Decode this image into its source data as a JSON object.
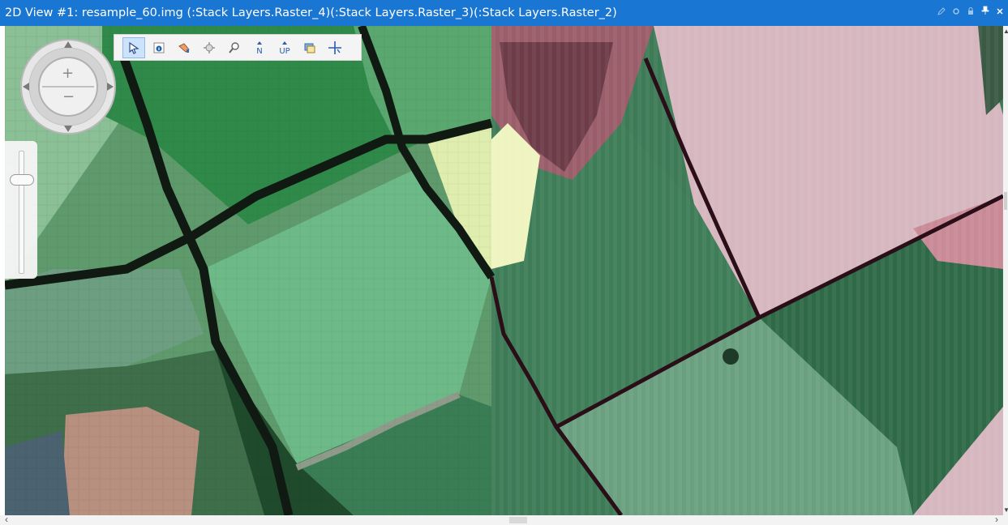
{
  "window": {
    "title": "2D View #1: resample_60.img (:Stack Layers.Raster_4)(:Stack Layers.Raster_3)(:Stack Layers.Raster_2)",
    "controls": [
      {
        "icon": "pencil-icon"
      },
      {
        "icon": "settings-icon"
      },
      {
        "icon": "lock-icon"
      },
      {
        "icon": "pin-icon"
      },
      {
        "icon": "close-icon"
      }
    ]
  },
  "toolbar": {
    "tools": [
      {
        "icon": "select-arrow-icon",
        "active": true
      },
      {
        "icon": "info-icon",
        "active": false
      },
      {
        "icon": "pan-hand-icon",
        "active": false
      },
      {
        "icon": "fit-extent-icon",
        "active": false
      },
      {
        "icon": "zoom-box-icon",
        "active": false
      },
      {
        "icon": "north-up-icon",
        "label": "N",
        "active": false
      },
      {
        "icon": "track-up-icon",
        "label": "UP",
        "active": false
      },
      {
        "icon": "layer-stack-icon",
        "active": false
      },
      {
        "icon": "crosshair-icon",
        "active": false
      }
    ]
  },
  "navigation": {
    "zoom_in_label": "+",
    "zoom_out_label": "−",
    "zoom_level": 0.75
  },
  "colors": {
    "titlebar": "#1976d2",
    "field_green_light": "#7cc28c",
    "field_green_mid": "#5aa870",
    "field_green_dark": "#3d7a56",
    "field_yellow": "#dfeeae",
    "field_pink": "#d6b6bf",
    "field_maroon": "#6d3c48",
    "boundary": "#101a12"
  }
}
